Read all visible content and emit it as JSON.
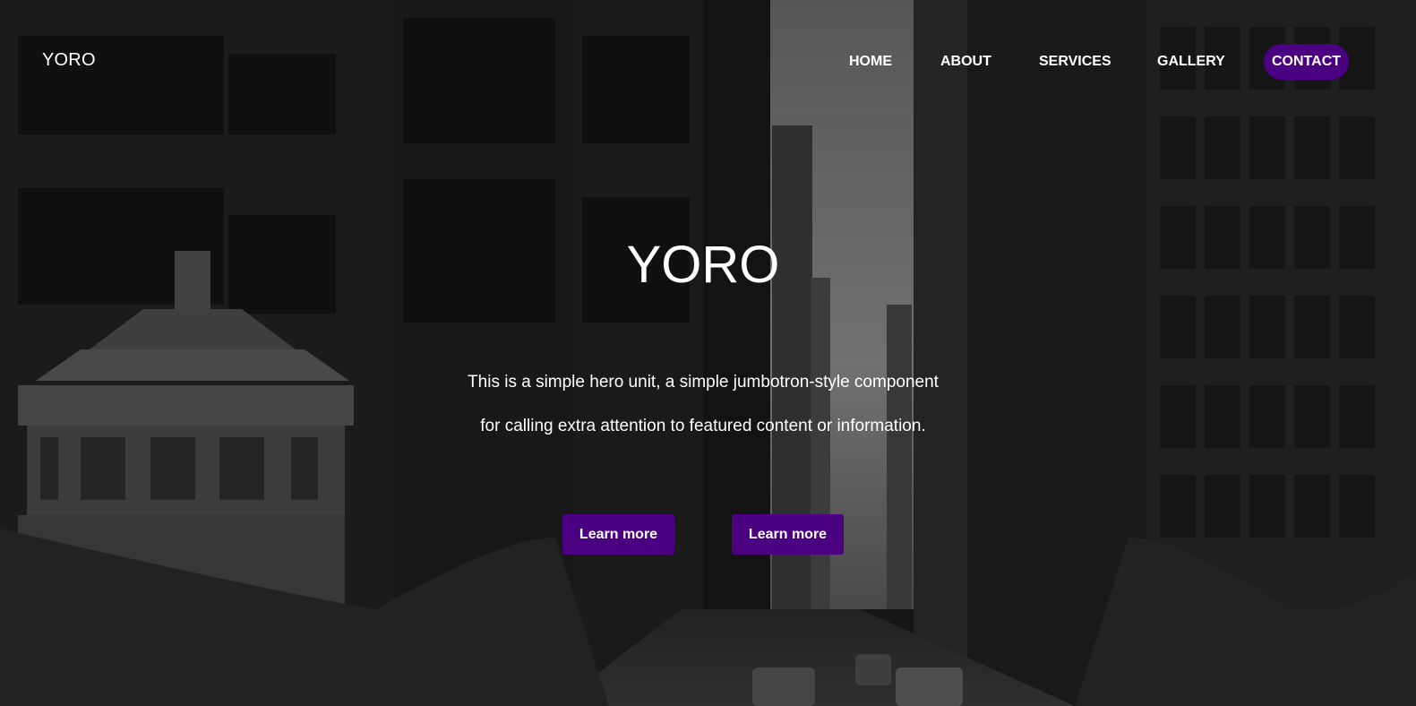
{
  "brand": {
    "name": "YORO"
  },
  "nav": {
    "items": [
      {
        "label": "HOME"
      },
      {
        "label": "ABOUT"
      },
      {
        "label": "SERVICES"
      },
      {
        "label": "GALLERY"
      },
      {
        "label": "CONTACT"
      }
    ]
  },
  "hero": {
    "title": "YORO",
    "line1": "This is a simple hero unit, a simple jumbotron-style component",
    "line2": "for calling extra attention to featured content or information.",
    "buttons": [
      {
        "label": "Learn more"
      },
      {
        "label": "Learn more"
      }
    ]
  },
  "colors": {
    "accent": "#4b0082",
    "text": "#ffffff",
    "background": "#151515"
  }
}
